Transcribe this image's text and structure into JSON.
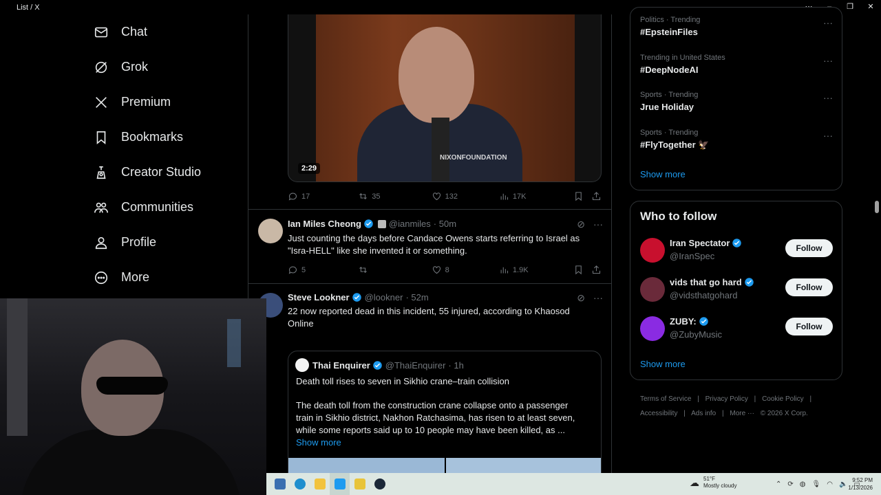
{
  "window": {
    "title": "List / X",
    "controls": [
      "⋯",
      "–",
      "❐",
      "✕"
    ]
  },
  "nav": [
    {
      "label": "Chat",
      "icon": "mail-icon"
    },
    {
      "label": "Grok",
      "icon": "grok-icon"
    },
    {
      "label": "Premium",
      "icon": "x-logo-icon"
    },
    {
      "label": "Bookmarks",
      "icon": "bookmark-icon"
    },
    {
      "label": "Creator Studio",
      "icon": "creator-studio-icon"
    },
    {
      "label": "Communities",
      "icon": "communities-icon"
    },
    {
      "label": "Profile",
      "icon": "profile-icon"
    },
    {
      "label": "More",
      "icon": "more-circle-icon"
    }
  ],
  "video_tweet": {
    "duration": "2:29",
    "watermark": "NIXONFOUNDATION",
    "replies": "17",
    "reposts": "35",
    "likes": "132",
    "views": "17K"
  },
  "tweets": [
    {
      "name": "Ian Miles Cheong",
      "handle": "@ianmiles",
      "time": "· 50m",
      "text_line1": "Just counting the days before Candace Owens starts referring to Israel as",
      "text_line2": "\"Isra-HELL\" like she invented it or something.",
      "replies": "5",
      "reposts": "",
      "likes": "8",
      "views": "1.9K"
    },
    {
      "name": "Steve Lookner",
      "handle": "@lookner",
      "time": "· 52m",
      "text_line1": "22 now reported dead in this incident, 55 injured, according to Khaosod",
      "text_line2": "Online",
      "quote": {
        "name": "Thai Enquirer",
        "handle": "@ThaiEnquirer",
        "time": "· 1h",
        "title": "Death toll rises to seven in Sikhio crane–train collision",
        "body_line1": "The death toll from the construction crane collapse onto a passenger",
        "body_line2": "train in Sikhio district, Nakhon Ratchasima, has risen to at least seven,",
        "body_line3": "while some reports said up to 10 people may have been killed, as ...",
        "show_more": "Show more"
      }
    }
  ],
  "trends": [
    {
      "meta": "Politics · Trending",
      "title": "#EpsteinFiles"
    },
    {
      "meta": "Trending in United States",
      "title": "#DeepNodeAI"
    },
    {
      "meta": "Sports · Trending",
      "title": "Jrue Holiday"
    },
    {
      "meta": "Sports · Trending",
      "title": "#FlyTogether 🦅"
    }
  ],
  "trends_show_more": "Show more",
  "who_to_follow": {
    "title": "Who to follow",
    "accounts": [
      {
        "name": "Iran Spectator",
        "handle": "@IranSpec",
        "button": "Follow",
        "color": "#c8102e"
      },
      {
        "name": "vids that go hard",
        "handle": "@vidsthatgohard",
        "button": "Follow",
        "color": "#6a2a3a"
      },
      {
        "name": "ZUBY:",
        "handle": "@ZubyMusic",
        "button": "Follow",
        "color": "#8a2be2"
      }
    ],
    "show_more": "Show more"
  },
  "footer": {
    "line1": [
      "Terms of Service",
      "|",
      "Privacy Policy",
      "|",
      "Cookie Policy",
      "|"
    ],
    "line2": [
      "Accessibility",
      "|",
      "Ads info",
      "|",
      "More ···",
      "© 2026 X Corp."
    ]
  },
  "taskbar": {
    "weather_temp": "51°F",
    "weather_desc": "Mostly cloudy",
    "time": "9:52 PM",
    "date": "1/13/2026",
    "apps": [
      {
        "name": "calculator-icon",
        "color": "#3a6fb0"
      },
      {
        "name": "edge-icon",
        "color": "#1f8fce"
      },
      {
        "name": "file-explorer-icon",
        "color": "#f2c33d"
      },
      {
        "name": "twitter-app-icon",
        "color": "#1d9bf0"
      },
      {
        "name": "puzzle-app-icon",
        "color": "#e8c43a"
      },
      {
        "name": "steam-icon",
        "color": "#1b2838"
      }
    ]
  },
  "colors": {
    "accent": "#1d9bf0",
    "background": "#000000",
    "border": "#2f3336",
    "muted": "#71767b"
  }
}
